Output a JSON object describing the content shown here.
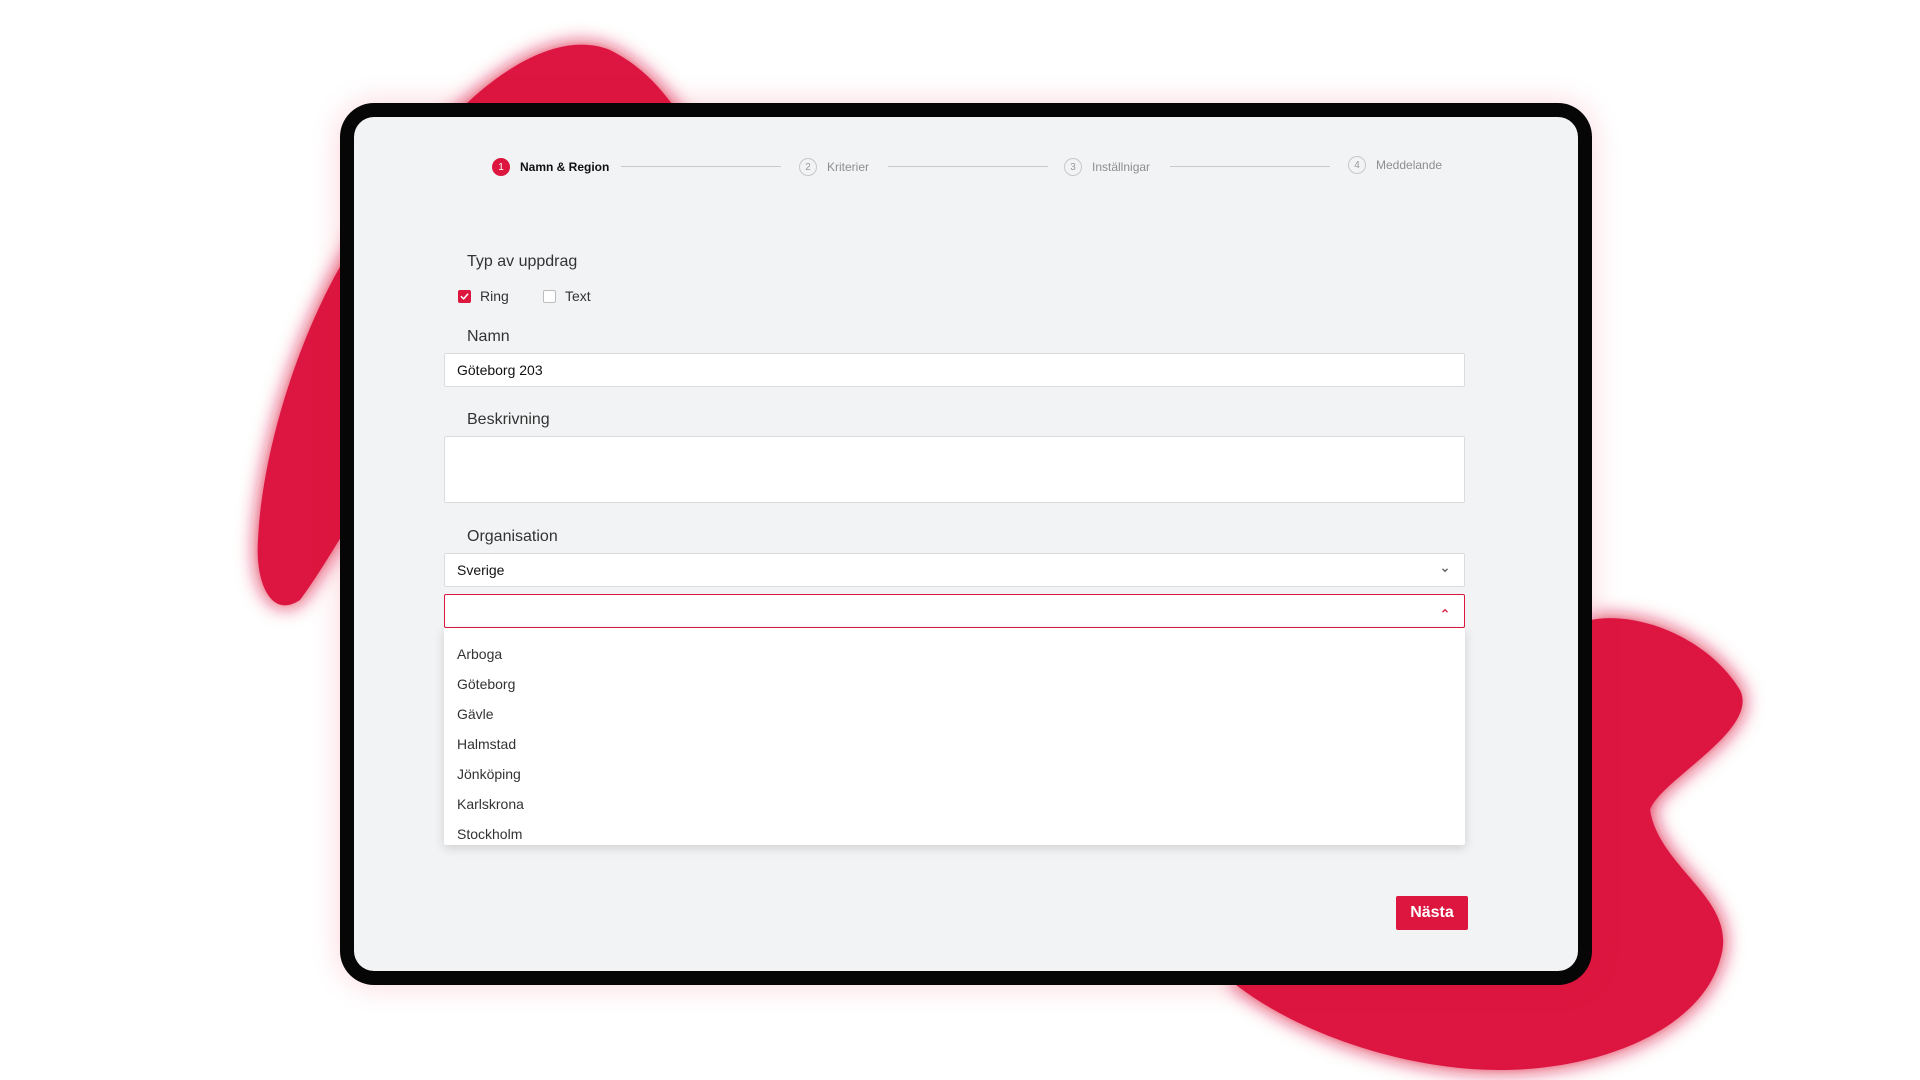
{
  "colors": {
    "accent": "#dc163f",
    "screen_bg": "#f2f3f4",
    "frame": "#060606"
  },
  "stepper": {
    "steps": [
      {
        "number": "1",
        "label": "Namn & Region",
        "active": true
      },
      {
        "number": "2",
        "label": "Kriterier",
        "active": false
      },
      {
        "number": "3",
        "label": "Inställnigar",
        "active": false
      },
      {
        "number": "4",
        "label": "Meddelande",
        "active": false
      }
    ]
  },
  "form": {
    "type_label": "Typ av uppdrag",
    "type_options": [
      {
        "label": "Ring",
        "checked": true
      },
      {
        "label": "Text",
        "checked": false
      }
    ],
    "name_label": "Namn",
    "name_value": "Göteborg 203",
    "description_label": "Beskrivning",
    "description_value": "",
    "organisation_label": "Organisation",
    "organisation_value": "Sverige",
    "region_value": "",
    "region_options": [
      "Arboga",
      "Göteborg",
      "Gävle",
      "Halmstad",
      "Jönköping",
      "Karlskrona",
      "Stockholm"
    ]
  },
  "actions": {
    "next_label": "Nästa"
  },
  "icons": {
    "dropdown_closed": "chevron-down-icon",
    "dropdown_open": "chevron-up-icon",
    "check": "check-icon"
  }
}
